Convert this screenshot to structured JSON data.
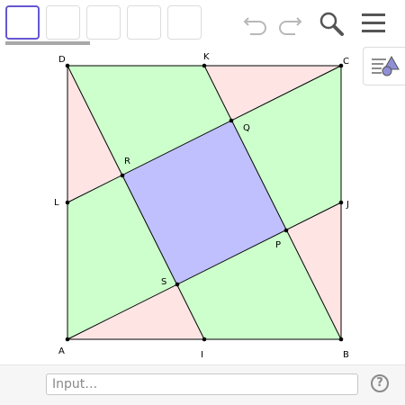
{
  "toolbar": {
    "tool_buttons": [
      "move-tool",
      "tool-2",
      "tool-3",
      "tool-4",
      "tool-5"
    ],
    "icons": [
      "undo-icon",
      "redo-icon",
      "search-icon",
      "menu-icon"
    ]
  },
  "style_bar": {
    "icon": "style-bar-icon"
  },
  "construction": {
    "points": [
      "A",
      "B",
      "C",
      "D",
      "I",
      "J",
      "K",
      "L",
      "P",
      "Q",
      "R",
      "S"
    ],
    "colors": {
      "square_fill": "#c0c0ff",
      "parallelogram_fill": "#ccffcc",
      "triangle_fill": "#ffe4e4",
      "stroke": "#000000"
    }
  },
  "input_bar": {
    "placeholder": "Input…"
  },
  "help": {
    "label": "?"
  }
}
